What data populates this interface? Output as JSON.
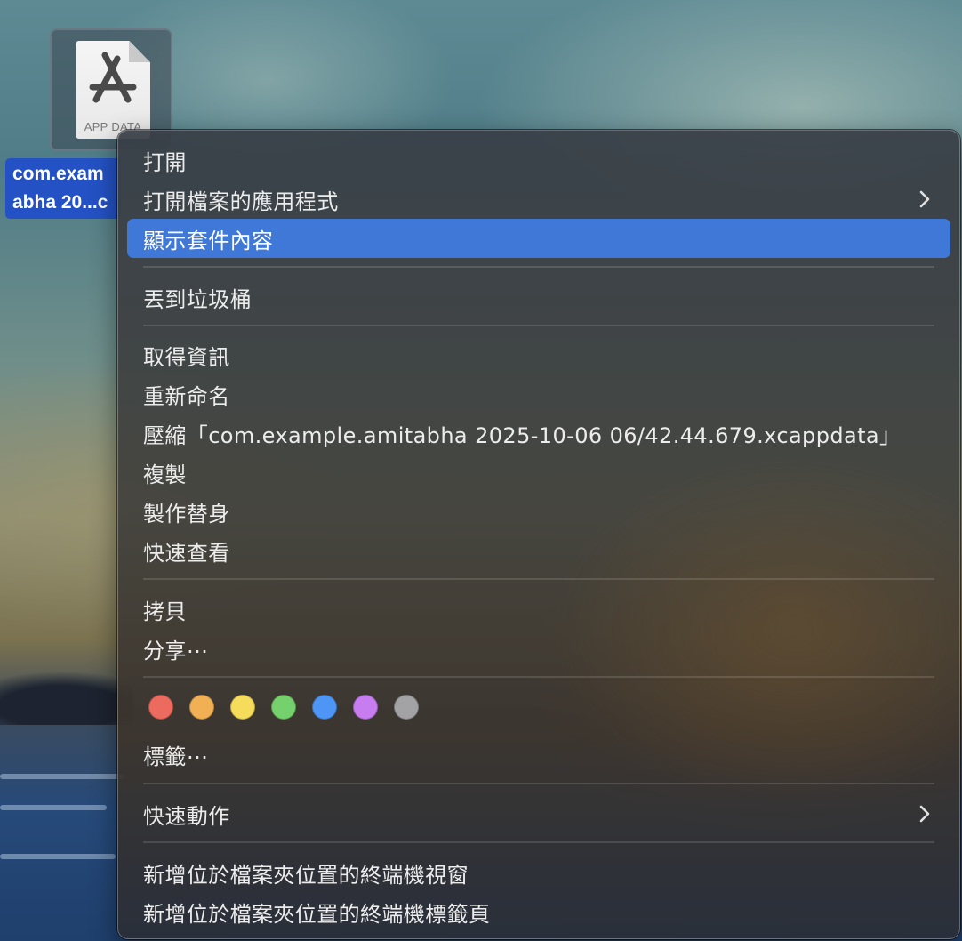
{
  "desktop": {
    "file": {
      "icon_label": "APP DATA",
      "name_line1": "com.exam",
      "name_line2": "abha 20...c",
      "icon": "app-store-document-icon"
    }
  },
  "context_menu": {
    "items": [
      {
        "label": "打開"
      },
      {
        "label": "打開檔案的應用程式",
        "submenu": true,
        "icon": "chevron-right-icon"
      },
      {
        "label": "顯示套件內容",
        "highlighted": true
      },
      {
        "label": "丟到垃圾桶"
      },
      {
        "label": "取得資訊"
      },
      {
        "label": "重新命名"
      },
      {
        "label": "壓縮「com.example.amitabha 2025-10-06 06/42.44.679.xcappdata」"
      },
      {
        "label": "複製"
      },
      {
        "label": "製作替身"
      },
      {
        "label": "快速查看"
      },
      {
        "label": "拷貝"
      },
      {
        "label": "分享⋯"
      },
      {
        "label": "標籤⋯"
      },
      {
        "label": "快速動作",
        "submenu": true,
        "icon": "chevron-right-icon"
      },
      {
        "label": "新增位於檔案夾位置的終端機視窗"
      },
      {
        "label": "新增位於檔案夾位置的終端機標籤頁"
      }
    ],
    "tag_colors": [
      {
        "name": "red",
        "color": "#ec6a5e"
      },
      {
        "name": "orange",
        "color": "#f2b054"
      },
      {
        "name": "yellow",
        "color": "#f5dc5a"
      },
      {
        "name": "green",
        "color": "#75d16c"
      },
      {
        "name": "blue",
        "color": "#4e96f5"
      },
      {
        "name": "purple",
        "color": "#c77cf0"
      },
      {
        "name": "gray",
        "color": "#a3a3a6"
      }
    ],
    "highlight_color": "#3f78d6"
  }
}
